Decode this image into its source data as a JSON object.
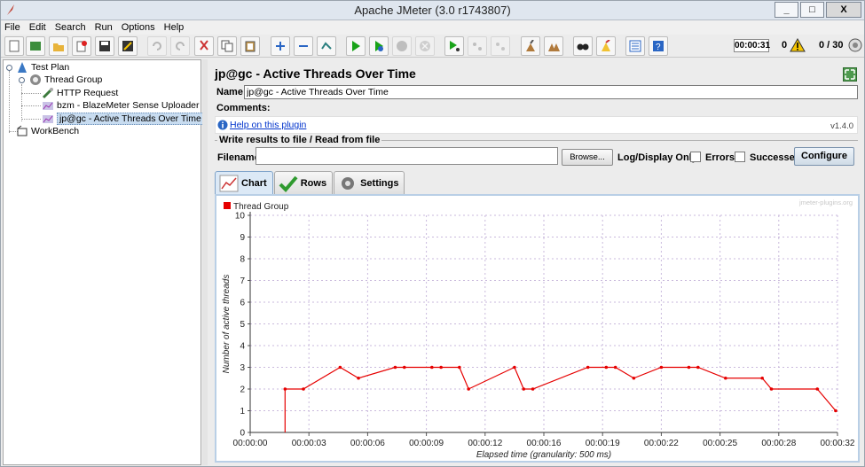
{
  "window": {
    "title": "Apache JMeter (3.0 r1743807)",
    "min": "_",
    "max": "□",
    "close": "X"
  },
  "menu": [
    "File",
    "Edit",
    "Search",
    "Run",
    "Options",
    "Help"
  ],
  "toolbar": {
    "icons": [
      "new-icon",
      "templates-icon",
      "open-icon",
      "close-icon",
      "save-icon",
      "save-snapshot-icon",
      "undo-icon",
      "redo-icon",
      "cut-icon",
      "copy-icon",
      "paste-icon",
      "expand-all-icon",
      "collapse-all-icon",
      "toggle-icon",
      "start-icon",
      "start-no-pause-icon",
      "stop-icon",
      "shutdown-icon",
      "remote-start-icon",
      "remote-stop-icon",
      "remote-shutdown-icon",
      "clear-icon",
      "clear-all-icon",
      "search-icon",
      "reset-search-icon",
      "function-helper-icon",
      "help-icon"
    ],
    "timer": "00:00:31",
    "error_count": "0",
    "threads": "0 / 30"
  },
  "tree": [
    {
      "label": "Test Plan",
      "icon": "test-plan-icon"
    },
    {
      "label": "Thread Group",
      "icon": "thread-group-icon"
    },
    {
      "label": "HTTP Request",
      "icon": "http-request-icon"
    },
    {
      "label": "bzm - BlazeMeter Sense Uploader",
      "icon": "uploader-icon"
    },
    {
      "label": "jp@gc - Active Threads Over Time",
      "icon": "chart-listener-icon"
    },
    {
      "label": "WorkBench",
      "icon": "workbench-icon"
    }
  ],
  "panel": {
    "title": "jp@gc - Active Threads Over Time",
    "name_label": "Name:",
    "name_value": "jp@gc - Active Threads Over Time",
    "comments_label": "Comments:",
    "help_link": "Help on this plugin",
    "version": "v1.4.0",
    "file_legend": "Write results to file / Read from file",
    "filename_label": "Filename",
    "filename_value": "",
    "browse": "Browse...",
    "log_only": "Log/Display Only:",
    "errors": "Errors",
    "successes": "Successes",
    "configure": "Configure",
    "tabs": [
      "Chart",
      "Rows",
      "Settings"
    ]
  },
  "chart_data": {
    "type": "line",
    "title": "",
    "watermark": "jmeter-plugins.org",
    "xlabel": "Elapsed time (granularity: 500 ms)",
    "ylabel": "Number of active threads",
    "ylim": [
      0,
      10
    ],
    "yticks": [
      "0",
      "1",
      "2",
      "3",
      "4",
      "5",
      "6",
      "7",
      "8",
      "9",
      "10"
    ],
    "xticks": [
      "00:00:00",
      "00:00:03",
      "00:00:06",
      "00:00:09",
      "00:00:12",
      "00:00:16",
      "00:00:19",
      "00:00:22",
      "00:00:25",
      "00:00:28",
      "00:00:32"
    ],
    "xlim": [
      0,
      32
    ],
    "series_color": "#e60000",
    "grid_color": "#c9b9dc",
    "legend_position": "top-left",
    "series": [
      {
        "name": "Thread Group",
        "x": [
          1.9,
          2.9,
          4.9,
          5.9,
          7.9,
          8.4,
          9.9,
          10.4,
          11.4,
          11.9,
          14.4,
          14.9,
          15.4,
          18.4,
          19.4,
          19.9,
          20.9,
          22.4,
          23.9,
          24.4,
          25.9,
          27.9,
          28.4,
          30.9,
          31.9
        ],
        "values": [
          2,
          2,
          3,
          2.5,
          3,
          3,
          3,
          3,
          3,
          2,
          3,
          2,
          2,
          3,
          3,
          3,
          2.5,
          3,
          3,
          3,
          2.5,
          2.5,
          2,
          2,
          1
        ],
        "start_drop_from": 0
      }
    ]
  }
}
